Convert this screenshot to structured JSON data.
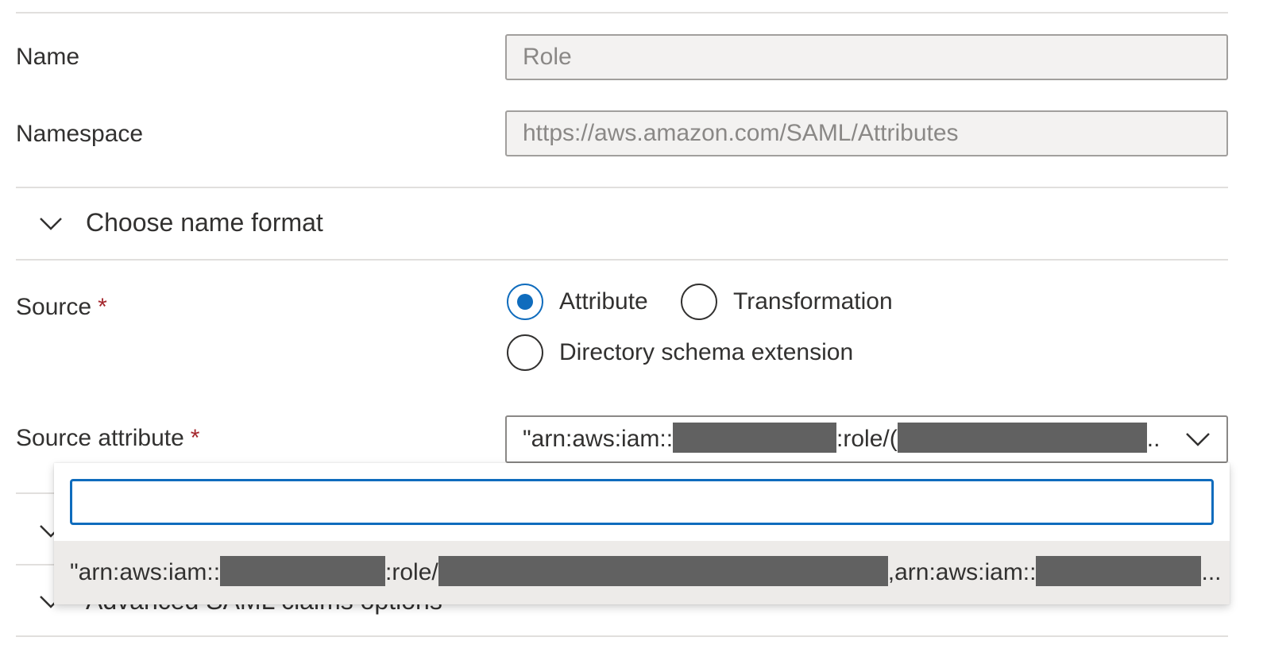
{
  "form": {
    "name": {
      "label": "Name",
      "value": "Role"
    },
    "namespace": {
      "label": "Namespace",
      "value": "https://aws.amazon.com/SAML/Attributes"
    }
  },
  "name_format_section": {
    "title": "Choose name format",
    "icon": "chevron-down-icon"
  },
  "source": {
    "label": "Source",
    "required_mark": "*",
    "options": [
      {
        "label": "Attribute",
        "selected": true
      },
      {
        "label": "Transformation",
        "selected": false
      },
      {
        "label": "Directory schema extension",
        "selected": false
      }
    ]
  },
  "source_attribute": {
    "label": "Source attribute",
    "required_mark": "*",
    "selected_parts": [
      "\"arn:aws:iam::",
      ":role/(",
      ".."
    ],
    "icon": "chevron-down-icon"
  },
  "dropdown": {
    "search_value": "",
    "option_parts": [
      "\"arn:aws:iam::",
      ":role/",
      ",arn:aws:iam::",
      "..."
    ]
  },
  "advanced_section": {
    "title": "Advanced SAML claims options",
    "icon": "chevron-down-icon"
  },
  "colors": {
    "accent": "#0f6cbd",
    "required": "#a4262c",
    "redaction": "#616161",
    "divider": "#e1dfdd"
  }
}
